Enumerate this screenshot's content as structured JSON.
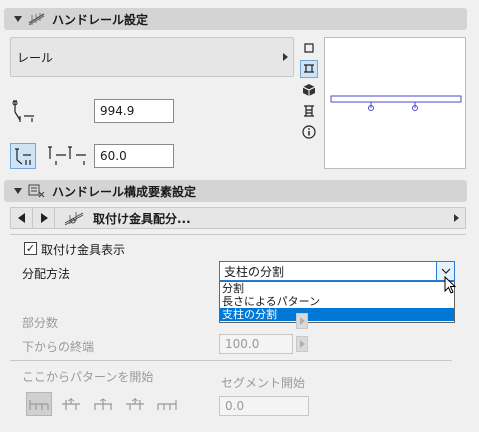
{
  "section1": {
    "title": "ハンドレール設定"
  },
  "rail_select": {
    "value": "レール"
  },
  "height_field": {
    "value": "994.9"
  },
  "offset_field": {
    "value": "60.0"
  },
  "section2": {
    "title": "ハンドレール構成要素設定"
  },
  "nav": {
    "title": "取付け金具配分..."
  },
  "show_fittings": {
    "label": "取付け金具表示",
    "checked": true
  },
  "distribution": {
    "label": "分配方法",
    "selected": "支柱の分割",
    "options": [
      "分割",
      "長さによるパターン",
      "支柱の分割"
    ]
  },
  "segments": {
    "label": "部分数"
  },
  "end_from_bottom": {
    "label": "下からの終端",
    "value": "100.0"
  },
  "pattern_start": {
    "label": "ここからパターンを開始"
  },
  "segment_start": {
    "label": "セグメント開始",
    "value": "0.0"
  },
  "colors": {
    "accent": "#0078d7",
    "preview_line": "#4a4ad0"
  }
}
